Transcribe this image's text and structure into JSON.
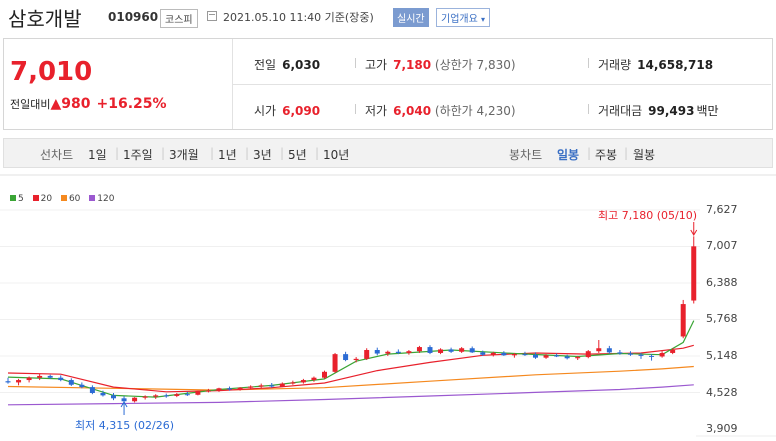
{
  "header": {
    "name": "삼호개발",
    "code": "010960",
    "market": "코스피",
    "timestamp": "2021.05.10 11:40 기준(장중)",
    "realtime": "실시간",
    "company_overview": "기업개요"
  },
  "quote": {
    "price": "7,010",
    "change_label": "전일대비",
    "change_value": "980",
    "change_pct": "+16.25%",
    "prev_label": "전일",
    "prev_value": "6,030",
    "high_label": "고가",
    "high_value": "7,180",
    "upper_limit": "(상한가 7,830)",
    "volume_label": "거래량",
    "volume_value": "14,658,718",
    "open_label": "시가",
    "open_value": "6,090",
    "low_label": "저가",
    "low_value": "6,040",
    "lower_limit": "(하한가 4,230)",
    "amount_label": "거래대금",
    "amount_value": "99,493",
    "amount_unit": "백만"
  },
  "periods": {
    "label": "선차트",
    "items": [
      "1일",
      "1주일",
      "3개월",
      "1년",
      "3년",
      "5년",
      "10년"
    ]
  },
  "candle": {
    "label": "봉차트",
    "items": [
      "일봉",
      "주봉",
      "월봉"
    ],
    "active": "일봉"
  },
  "legend": [
    {
      "label": "5",
      "color": "#3aa535"
    },
    {
      "label": "20",
      "color": "#e8212c"
    },
    {
      "label": "60",
      "color": "#f5891f"
    },
    {
      "label": "120",
      "color": "#9b59d0"
    }
  ],
  "colors": {
    "up": "#e8212c",
    "down": "#2b6bd4",
    "accent": "#3a6fc4"
  },
  "chart_data": {
    "type": "candlestick",
    "y_ticks": [
      "7,627",
      "7,007",
      "6,388",
      "5,768",
      "5,148",
      "4,528",
      "3,909"
    ],
    "ylim": [
      3909,
      7627
    ],
    "max_annotation": "최고 7,180 (05/10)",
    "min_annotation": "최저 4,315 (02/26)",
    "candles": [
      [
        4720,
        4780,
        4680,
        4700
      ],
      [
        4700,
        4760,
        4650,
        4740
      ],
      [
        4740,
        4800,
        4700,
        4780
      ],
      [
        4780,
        4850,
        4740,
        4810
      ],
      [
        4810,
        4830,
        4760,
        4780
      ],
      [
        4780,
        4820,
        4720,
        4740
      ],
      [
        4740,
        4770,
        4640,
        4660
      ],
      [
        4660,
        4700,
        4600,
        4620
      ],
      [
        4620,
        4650,
        4500,
        4520
      ],
      [
        4520,
        4560,
        4460,
        4480
      ],
      [
        4480,
        4520,
        4400,
        4430
      ],
      [
        4430,
        4470,
        4315,
        4380
      ],
      [
        4380,
        4450,
        4360,
        4440
      ],
      [
        4440,
        4480,
        4410,
        4460
      ],
      [
        4460,
        4500,
        4420,
        4480
      ],
      [
        4480,
        4510,
        4440,
        4470
      ],
      [
        4470,
        4520,
        4450,
        4500
      ],
      [
        4500,
        4540,
        4470,
        4490
      ],
      [
        4490,
        4560,
        4480,
        4550
      ],
      [
        4550,
        4590,
        4530,
        4560
      ],
      [
        4560,
        4610,
        4540,
        4600
      ],
      [
        4600,
        4630,
        4560,
        4580
      ],
      [
        4580,
        4620,
        4560,
        4610
      ],
      [
        4610,
        4650,
        4590,
        4630
      ],
      [
        4630,
        4680,
        4600,
        4650
      ],
      [
        4650,
        4690,
        4610,
        4630
      ],
      [
        4630,
        4700,
        4620,
        4680
      ],
      [
        4680,
        4730,
        4660,
        4700
      ],
      [
        4700,
        4760,
        4680,
        4740
      ],
      [
        4740,
        4800,
        4710,
        4780
      ],
      [
        4780,
        4900,
        4760,
        4880
      ],
      [
        4880,
        5200,
        4860,
        5180
      ],
      [
        5180,
        5220,
        5060,
        5080
      ],
      [
        5080,
        5130,
        5040,
        5100
      ],
      [
        5100,
        5280,
        5080,
        5250
      ],
      [
        5250,
        5290,
        5160,
        5190
      ],
      [
        5190,
        5240,
        5150,
        5220
      ],
      [
        5220,
        5260,
        5180,
        5200
      ],
      [
        5200,
        5250,
        5170,
        5230
      ],
      [
        5230,
        5320,
        5200,
        5300
      ],
      [
        5300,
        5330,
        5180,
        5200
      ],
      [
        5200,
        5280,
        5180,
        5260
      ],
      [
        5260,
        5290,
        5200,
        5220
      ],
      [
        5220,
        5300,
        5200,
        5280
      ],
      [
        5280,
        5310,
        5200,
        5210
      ],
      [
        5210,
        5240,
        5150,
        5170
      ],
      [
        5170,
        5220,
        5140,
        5200
      ],
      [
        5200,
        5230,
        5150,
        5160
      ],
      [
        5160,
        5200,
        5120,
        5180
      ],
      [
        5180,
        5220,
        5150,
        5170
      ],
      [
        5170,
        5210,
        5100,
        5120
      ],
      [
        5120,
        5180,
        5100,
        5160
      ],
      [
        5160,
        5190,
        5130,
        5140
      ],
      [
        5140,
        5170,
        5090,
        5110
      ],
      [
        5110,
        5150,
        5080,
        5130
      ],
      [
        5130,
        5250,
        5110,
        5230
      ],
      [
        5230,
        5420,
        5200,
        5280
      ],
      [
        5280,
        5320,
        5190,
        5210
      ],
      [
        5210,
        5250,
        5170,
        5190
      ],
      [
        5190,
        5230,
        5150,
        5170
      ],
      [
        5170,
        5200,
        5100,
        5150
      ],
      [
        5150,
        5180,
        5070,
        5140
      ],
      [
        5140,
        5230,
        5120,
        5200
      ],
      [
        5200,
        5280,
        5180,
        5250
      ],
      [
        5480,
        6100,
        5450,
        6030
      ],
      [
        6090,
        7180,
        6040,
        7010
      ]
    ],
    "ma": {
      "5": [
        [
          0,
          4790
        ],
        [
          5,
          4760
        ],
        [
          10,
          4480
        ],
        [
          14,
          4450
        ],
        [
          20,
          4580
        ],
        [
          25,
          4650
        ],
        [
          30,
          4760
        ],
        [
          33,
          5060
        ],
        [
          36,
          5180
        ],
        [
          42,
          5250
        ],
        [
          48,
          5190
        ],
        [
          54,
          5140
        ],
        [
          58,
          5190
        ],
        [
          62,
          5170
        ],
        [
          64,
          5380
        ],
        [
          65,
          5750
        ]
      ],
      "20": [
        [
          0,
          4860
        ],
        [
          5,
          4840
        ],
        [
          10,
          4620
        ],
        [
          15,
          4540
        ],
        [
          20,
          4560
        ],
        [
          25,
          4610
        ],
        [
          30,
          4690
        ],
        [
          35,
          4900
        ],
        [
          40,
          5040
        ],
        [
          45,
          5160
        ],
        [
          50,
          5200
        ],
        [
          55,
          5180
        ],
        [
          60,
          5200
        ],
        [
          64,
          5280
        ],
        [
          65,
          5330
        ]
      ],
      "60": [
        [
          0,
          4630
        ],
        [
          10,
          4600
        ],
        [
          20,
          4570
        ],
        [
          30,
          4610
        ],
        [
          40,
          4720
        ],
        [
          50,
          4830
        ],
        [
          58,
          4890
        ],
        [
          62,
          4930
        ],
        [
          65,
          4970
        ]
      ],
      "120": [
        [
          0,
          4320
        ],
        [
          10,
          4340
        ],
        [
          20,
          4360
        ],
        [
          30,
          4410
        ],
        [
          40,
          4470
        ],
        [
          50,
          4530
        ],
        [
          58,
          4580
        ],
        [
          62,
          4620
        ],
        [
          65,
          4660
        ]
      ]
    }
  }
}
